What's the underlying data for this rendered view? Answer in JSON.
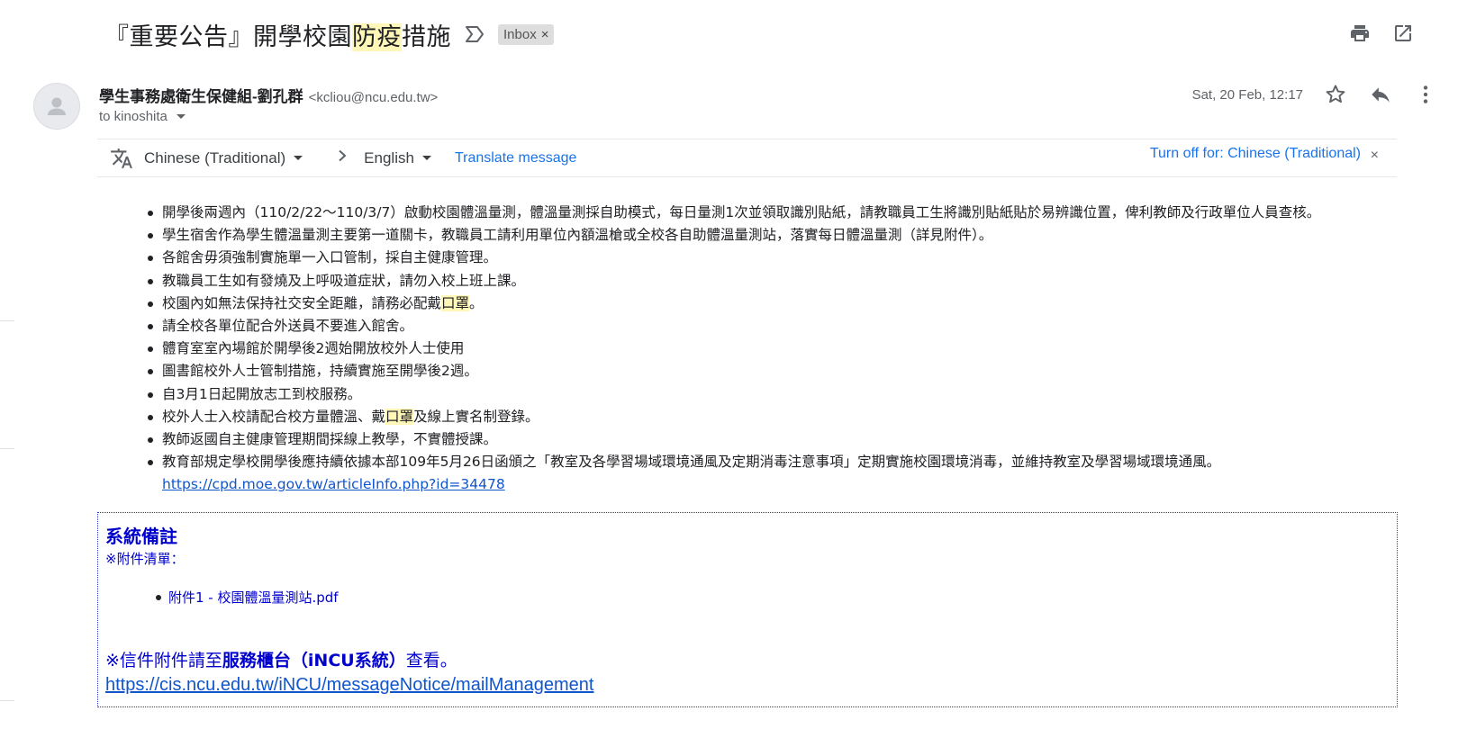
{
  "subject": {
    "before": "『重要公告』開學校園",
    "highlight": "防疫",
    "after": "措施"
  },
  "label": {
    "text": "Inbox",
    "remove": "×"
  },
  "sender": {
    "name": "學生事務處衛生保健組-劉孔群",
    "email": "<kcliou@ncu.edu.tw>",
    "to": "to kinoshita"
  },
  "date": "Sat, 20 Feb, 12:17",
  "translate": {
    "from_lang": "Chinese (Traditional)",
    "to_lang": "English",
    "translate_link": "Translate message",
    "turn_off": "Turn off for: Chinese (Traditional)",
    "close": "×"
  },
  "items": [
    "開學後兩週內（110/2/22～110/3/7）啟動校園體溫量測，體溫量測採自助模式，每日量測1次並領取識別貼紙，請教職員工生將識別貼紙貼於易辨識位置，俾利教師及行政單位人員查核。",
    "學生宿舍作為學生體溫量測主要第一道關卡，教職員工請利用單位內額溫槍或全校各自助體溫量測站，落實每日體溫量測（詳見附件）。",
    "各館舍毋須強制實施單一入口管制，採自主健康管理。",
    "教職員工生如有發燒及上呼吸道症狀，請勿入校上班上課。",
    {
      "before": "校園內如無法保持社交安全距離，請務必配戴",
      "highlight": "口罩",
      "after": "。"
    },
    "請全校各單位配合外送員不要進入館舍。",
    "體育室室內場館於開學後2週始開放校外人士使用",
    "圖書館校外人士管制措施，持續實施至開學後2週。",
    "自3月1日起開放志工到校服務。",
    {
      "before": "校外人士入校請配合校方量體溫、戴",
      "highlight": "口罩",
      "after": "及線上實名制登錄。"
    },
    "教師返國自主健康管理期間採線上教學，不實體授課。",
    {
      "before": "教育部規定學校開學後應持續依據本部109年5月26日函頒之「教室及各學習場域環境通風及定期消毒注意事項」定期實施校園環境消毒，並維持教室及學習場域環境通風。",
      "link": "https://cpd.moe.gov.tw/articleInfo.php?id=34478"
    }
  ],
  "notes": {
    "title": "系統備註",
    "subtitle": "※附件清單：",
    "attachment": "附件1 - 校園體溫量測站.pdf",
    "help_before": "※信件附件請至",
    "help_bold": "服務櫃台（iNCU系統）",
    "help_after": "查看。",
    "url": "https://cis.ncu.edu.tw/iNCU/messageNotice/mailManagement"
  },
  "icons": {
    "important": "important-marker-icon",
    "print": "print-icon",
    "new_window": "open-in-new-window-icon",
    "star": "star-icon",
    "reply": "reply-icon",
    "more": "more-vertical-icon",
    "translate": "translate-icon",
    "avatar": "default-avatar-icon"
  },
  "colors": {
    "link": "#1a73e8",
    "highlight": "#fff7b8",
    "notes_text": "#0000cc",
    "notes_border": "#2a3ad8",
    "label_chip": "#dddddd"
  }
}
